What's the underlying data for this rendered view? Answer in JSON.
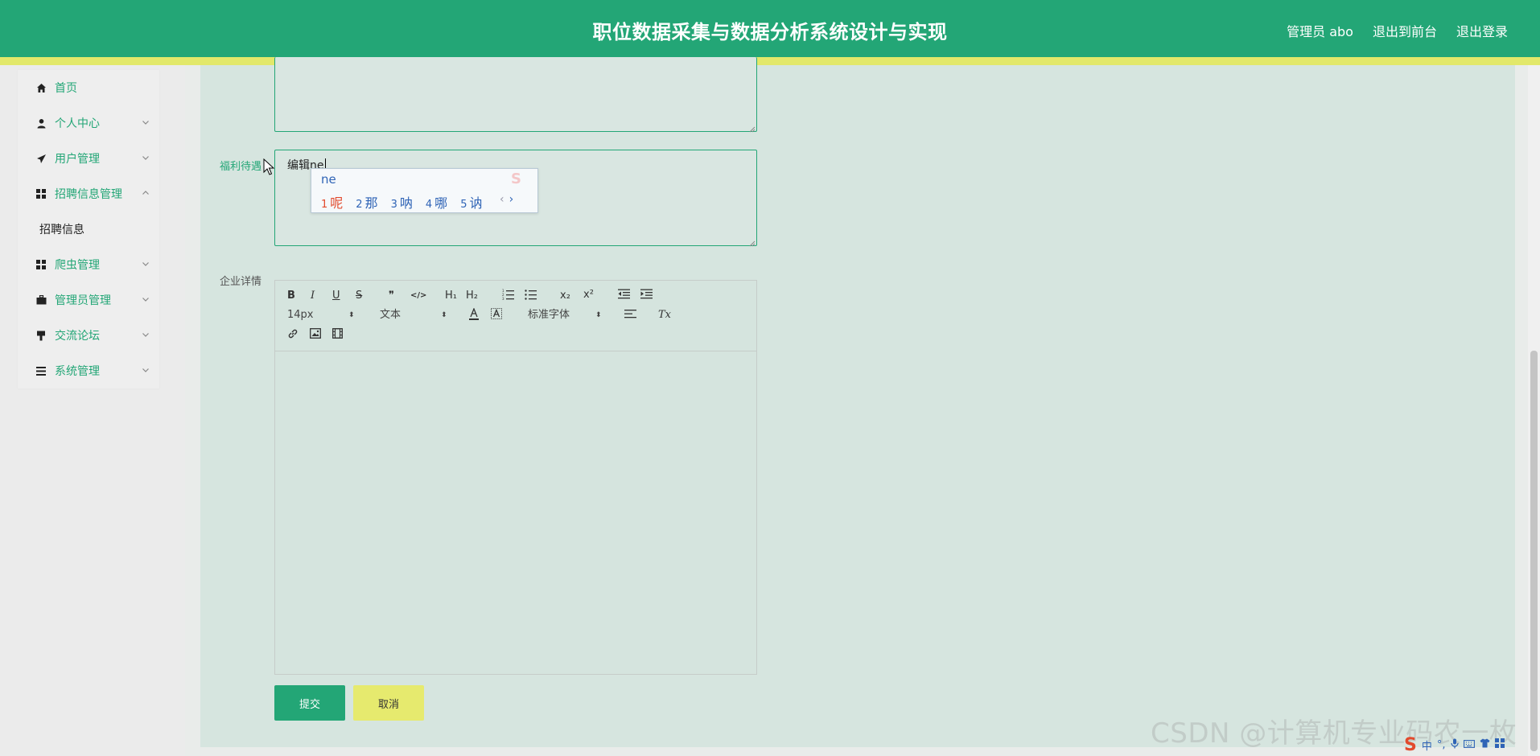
{
  "header": {
    "title": "职位数据采集与数据分析系统设计与实现",
    "links": [
      "管理员 abo",
      "退出到前台",
      "退出登录"
    ],
    "bg_color": "#23a676",
    "stripe_color": "#e2e86a"
  },
  "sidebar": {
    "items": [
      {
        "label": "首页",
        "icon": "home-icon",
        "expandable": false
      },
      {
        "label": "个人中心",
        "icon": "user-icon",
        "expandable": true
      },
      {
        "label": "用户管理",
        "icon": "paper-plane-icon",
        "expandable": true
      },
      {
        "label": "招聘信息管理",
        "icon": "grid-icon",
        "expandable": true
      },
      {
        "label": "爬虫管理",
        "icon": "grid-icon",
        "expandable": true
      },
      {
        "label": "管理员管理",
        "icon": "briefcase-icon",
        "expandable": true
      },
      {
        "label": "交流论坛",
        "icon": "brush-icon",
        "expandable": true
      },
      {
        "label": "系统管理",
        "icon": "list-icon",
        "expandable": true
      }
    ],
    "sub_item": "招聘信息"
  },
  "form": {
    "welfare_label": "福利待遇",
    "welfare_value": "编辑ne",
    "details_label": "企业详情",
    "submit_label": "提交",
    "cancel_label": "取消"
  },
  "ime": {
    "input": "ne",
    "candidates": [
      {
        "num": "1",
        "text": "呢"
      },
      {
        "num": "2",
        "text": "那"
      },
      {
        "num": "3",
        "text": "呐"
      },
      {
        "num": "4",
        "text": "哪"
      },
      {
        "num": "5",
        "text": "讷"
      }
    ],
    "prev": "‹",
    "next": "›"
  },
  "editor": {
    "font_size": "14px",
    "text_type": "文本",
    "font_family": "标准字体",
    "h1": "H₁",
    "h2": "H₂",
    "sub": "x₂",
    "sup": "x²",
    "bold": "B",
    "italic": "I",
    "underline": "U",
    "strike": "S",
    "quote": "❞",
    "code": "</>",
    "clear": "Tx"
  },
  "watermark": "CSDN @计算机专业码农一枚",
  "tray": {
    "lang": "中"
  }
}
